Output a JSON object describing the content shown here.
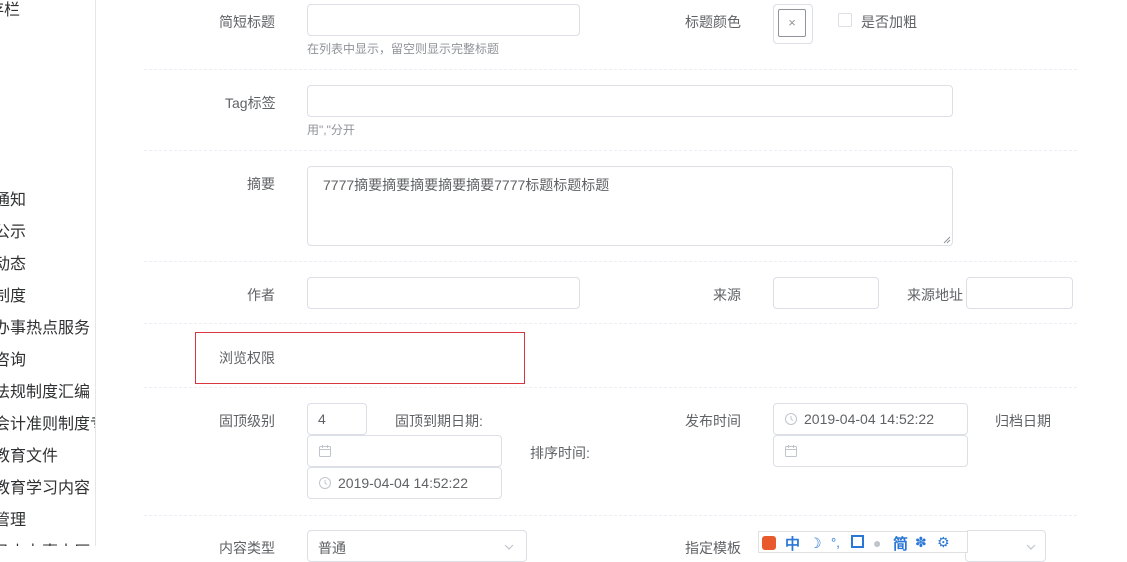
{
  "sidebar": {
    "items": [
      {
        "label": "存栏"
      },
      {
        "label": "通知"
      },
      {
        "label": "公示"
      },
      {
        "label": "动态"
      },
      {
        "label": "制度"
      },
      {
        "label": "办事热点服务"
      },
      {
        "label": "咨询"
      },
      {
        "label": "法规制度汇编"
      },
      {
        "label": "会计准则制度专"
      },
      {
        "label": "教育文件"
      },
      {
        "label": "教育学习内容"
      },
      {
        "label": "管理"
      },
      {
        "label": "马上办事大厅"
      }
    ]
  },
  "form": {
    "short_title": {
      "label": "简短标题",
      "value": "",
      "hint": "在列表中显示，留空则显示完整标题"
    },
    "title_color": {
      "label": "标题颜色",
      "clear_symbol": "×"
    },
    "bold": {
      "label": "是否加粗",
      "checked": false
    },
    "tag": {
      "label": "Tag标签",
      "value": "",
      "hint": "用\",\"分开"
    },
    "summary": {
      "label": "摘要",
      "value": "7777摘要摘要摘要摘要摘要7777标题标题标题"
    },
    "author": {
      "label": "作者",
      "value": ""
    },
    "source": {
      "label": "来源",
      "value": ""
    },
    "source_url": {
      "label": "来源地址",
      "value": ""
    },
    "permission": {
      "label": "浏览权限"
    },
    "pin_level": {
      "label": "固顶级别",
      "value": "4"
    },
    "pin_expire": {
      "label": "固顶到期日期:",
      "value": ""
    },
    "sort_time": {
      "label": "排序时间:",
      "value": ""
    },
    "sort_time_value": {
      "value": "2019-04-04 14:52:22"
    },
    "publish_time": {
      "label": "发布时间",
      "value": "2019-04-04 14:52:22"
    },
    "archive_date": {
      "label": "归档日期",
      "value": ""
    },
    "content_type": {
      "label": "内容类型",
      "value": "普通"
    },
    "template": {
      "label": "指定模板",
      "value": ""
    }
  },
  "colors": {
    "accent": "#d9363e",
    "border": "#dcdfe6",
    "label": "#606266",
    "hint": "#909399"
  },
  "icons": [
    "clock-icon",
    "calendar-icon",
    "chevron-down-icon",
    "close-icon",
    "ime-toolbar"
  ]
}
